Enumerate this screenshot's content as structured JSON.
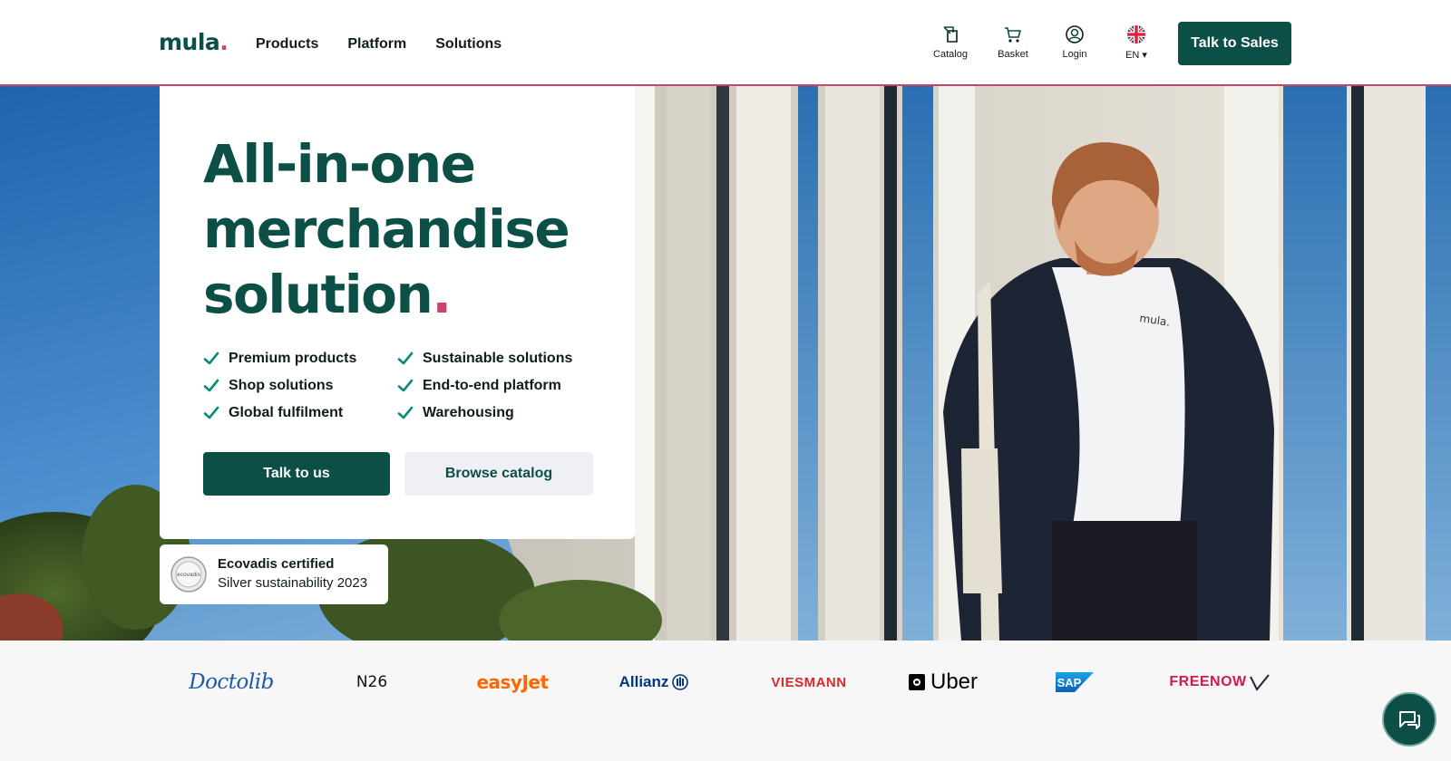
{
  "header": {
    "logo": {
      "text": "mula",
      "dot": "."
    },
    "nav": [
      {
        "label": "Products"
      },
      {
        "label": "Platform"
      },
      {
        "label": "Solutions"
      }
    ],
    "utilities": {
      "catalog": {
        "label": "Catalog",
        "icon": "catalog-icon"
      },
      "basket": {
        "label": "Basket",
        "icon": "basket-icon"
      },
      "login": {
        "label": "Login",
        "icon": "user-icon"
      },
      "language": {
        "label": "EN ▾",
        "icon": "uk-flag-icon"
      }
    },
    "cta": "Talk to Sales"
  },
  "hero": {
    "headline": [
      "All-in-one",
      "merchandise",
      "solution"
    ],
    "headline_dot": ".",
    "features": [
      "Premium products",
      "Sustainable solutions",
      "Shop solutions",
      "End-to-end platform",
      "Global fulfilment",
      "Warehousing"
    ],
    "primary_button": "Talk to us",
    "secondary_button": "Browse catalog",
    "badge": {
      "title": "Ecovadis certified",
      "subtitle": "Silver sustainability 2023",
      "seal_text": "ecovadis"
    },
    "shirt_print": "mula."
  },
  "client_logos": {
    "doctolib": "Doctolib",
    "n26": "N26",
    "easyjet": "easyJet",
    "allianz": "Allianz",
    "viessmann": "VIESMANN",
    "uber": "Uber",
    "sap": "SAP",
    "freenow": "FREENOW"
  },
  "colors": {
    "brand_green": "#0b4f47",
    "accent_pink": "#c9456b",
    "secondary_button_bg": "#eef0f6"
  },
  "chat": {
    "icon": "chat-icon"
  }
}
